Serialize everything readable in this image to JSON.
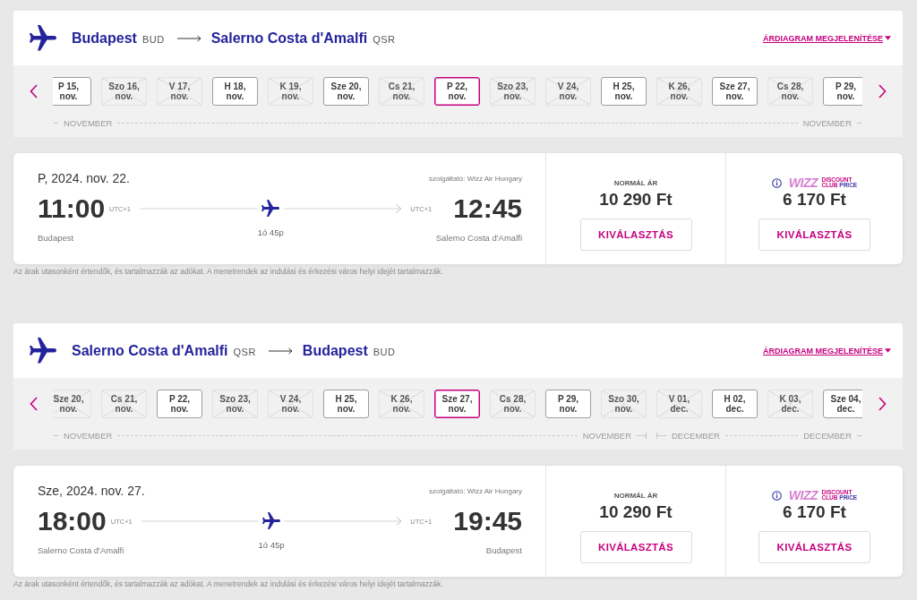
{
  "flights": [
    {
      "route_header": {
        "origin": {
          "city": "Budapest",
          "code": "BUD"
        },
        "destination": {
          "city": "Salerno Costa d'Amalfi",
          "code": "QSR"
        },
        "price_chart_link": "ÁRDIAGRAM MEGJELENÍTÉSE"
      },
      "date_strip": {
        "months": [
          {
            "start_label": "NOVEMBER",
            "end_label": "NOVEMBER",
            "dates": [
              {
                "day": "P 15,",
                "month": "nov.",
                "available": true,
                "selected": false
              },
              {
                "day": "Szo 16,",
                "month": "nov.",
                "available": false,
                "selected": false
              },
              {
                "day": "V 17,",
                "month": "nov.",
                "available": false,
                "selected": false
              },
              {
                "day": "H 18,",
                "month": "nov.",
                "available": true,
                "selected": false
              },
              {
                "day": "K 19,",
                "month": "nov.",
                "available": false,
                "selected": false
              },
              {
                "day": "Sze 20,",
                "month": "nov.",
                "available": true,
                "selected": false
              },
              {
                "day": "Cs 21,",
                "month": "nov.",
                "available": false,
                "selected": false
              },
              {
                "day": "P 22,",
                "month": "nov.",
                "available": true,
                "selected": true
              },
              {
                "day": "Szo 23,",
                "month": "nov.",
                "available": false,
                "selected": false
              },
              {
                "day": "V 24,",
                "month": "nov.",
                "available": false,
                "selected": false
              },
              {
                "day": "H 25,",
                "month": "nov.",
                "available": true,
                "selected": false
              },
              {
                "day": "K 26,",
                "month": "nov.",
                "available": false,
                "selected": false
              },
              {
                "day": "Sze 27,",
                "month": "nov.",
                "available": true,
                "selected": false
              },
              {
                "day": "Cs 28,",
                "month": "nov.",
                "available": false,
                "selected": false
              },
              {
                "day": "P 29,",
                "month": "nov.",
                "available": true,
                "selected": false
              }
            ]
          }
        ]
      },
      "flight": {
        "date": "P, 2024. nov. 22.",
        "operator": "szolgáltató: Wizz Air Hungary",
        "departure": {
          "time": "11:00",
          "timezone": "UTC+1",
          "city": "Budapest"
        },
        "arrival": {
          "time": "12:45",
          "timezone": "UTC+1",
          "city": "Salerno Costa d'Amalfi"
        },
        "duration": "1ó 45p",
        "fares": [
          {
            "kind": "normal",
            "label": "NORMÁL ÁR",
            "price": "10 290 Ft",
            "button": "KIVÁLASZTÁS"
          },
          {
            "kind": "club",
            "logo": {
              "brand": "WIZZ",
              "top": "DISCOUNT",
              "bottom_left": "CLUB",
              "bottom_right": "PRICE"
            },
            "price": "6 170 Ft",
            "button": "KIVÁLASZTÁS"
          }
        ]
      },
      "footnote": "Az árak utasonként értendők, és tartalmazzák az adókat. A menetrendek az indulási és érkezési város helyi idejét tartalmazzák."
    },
    {
      "route_header": {
        "origin": {
          "city": "Salerno Costa d'Amalfi",
          "code": "QSR"
        },
        "destination": {
          "city": "Budapest",
          "code": "BUD"
        },
        "price_chart_link": "ÁRDIAGRAM MEGJELENÍTÉSE"
      },
      "date_strip": {
        "months": [
          {
            "start_label": "NOVEMBER",
            "end_label": "NOVEMBER",
            "dates": [
              {
                "day": "Sze 20,",
                "month": "nov.",
                "available": false,
                "selected": false
              },
              {
                "day": "Cs 21,",
                "month": "nov.",
                "available": false,
                "selected": false
              },
              {
                "day": "P 22,",
                "month": "nov.",
                "available": true,
                "selected": false
              },
              {
                "day": "Szo 23,",
                "month": "nov.",
                "available": false,
                "selected": false
              },
              {
                "day": "V 24,",
                "month": "nov.",
                "available": false,
                "selected": false
              },
              {
                "day": "H 25,",
                "month": "nov.",
                "available": true,
                "selected": false
              },
              {
                "day": "K 26,",
                "month": "nov.",
                "available": false,
                "selected": false
              },
              {
                "day": "Sze 27,",
                "month": "nov.",
                "available": true,
                "selected": true
              },
              {
                "day": "Cs 28,",
                "month": "nov.",
                "available": false,
                "selected": false
              },
              {
                "day": "P 29,",
                "month": "nov.",
                "available": true,
                "selected": false
              },
              {
                "day": "Szo 30,",
                "month": "nov.",
                "available": false,
                "selected": false
              }
            ]
          },
          {
            "start_label": "DECEMBER",
            "end_label": "DECEMBER",
            "dates": [
              {
                "day": "V 01,",
                "month": "dec.",
                "available": false,
                "selected": false
              },
              {
                "day": "H 02,",
                "month": "dec.",
                "available": true,
                "selected": false
              },
              {
                "day": "K 03,",
                "month": "dec.",
                "available": false,
                "selected": false
              },
              {
                "day": "Sze 04,",
                "month": "dec.",
                "available": true,
                "selected": false
              }
            ]
          }
        ]
      },
      "flight": {
        "date": "Sze, 2024. nov. 27.",
        "operator": "szolgáltató: Wizz Air Hungary",
        "departure": {
          "time": "18:00",
          "timezone": "UTC+1",
          "city": "Salerno Costa d'Amalfi"
        },
        "arrival": {
          "time": "19:45",
          "timezone": "UTC+1",
          "city": "Budapest"
        },
        "duration": "1ó 45p",
        "fares": [
          {
            "kind": "normal",
            "label": "NORMÁL ÁR",
            "price": "10 290 Ft",
            "button": "KIVÁLASZTÁS"
          },
          {
            "kind": "club",
            "logo": {
              "brand": "WIZZ",
              "top": "DISCOUNT",
              "bottom_left": "CLUB",
              "bottom_right": "PRICE"
            },
            "price": "6 170 Ft",
            "button": "KIVÁLASZTÁS"
          }
        ]
      },
      "footnote": "Az árak utasonként értendők, és tartalmazzák az adókat. A menetrendek az indulási és érkezési város helyi idejét tartalmazzák."
    }
  ]
}
